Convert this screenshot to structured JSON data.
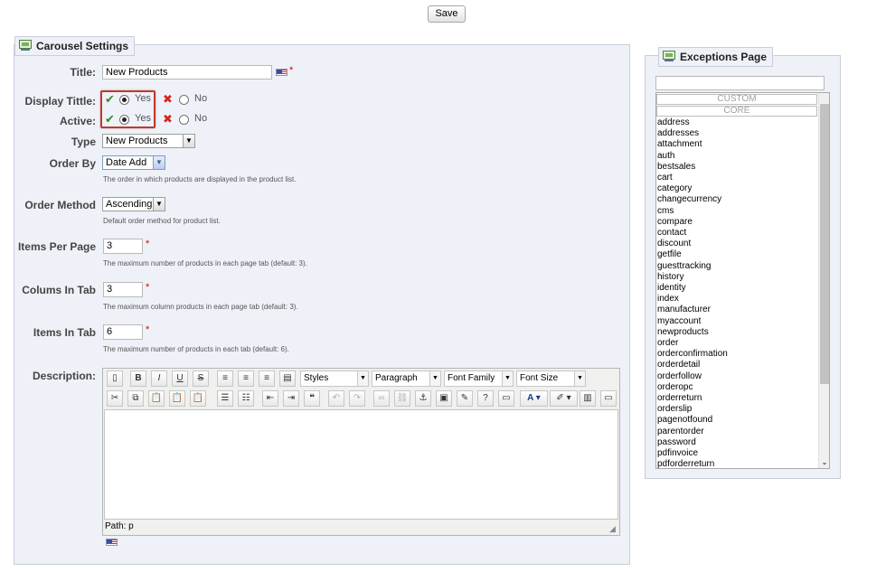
{
  "toolbar": {
    "save_label": "Save"
  },
  "carousel": {
    "legend": "Carousel Settings",
    "title_label": "Title:",
    "title_value": "New Products",
    "display_title_label": "Display Tittle:",
    "active_label": "Active:",
    "yes_label": "Yes",
    "no_label": "No",
    "type_label": "Type",
    "type_value": "New Products",
    "order_by_label": "Order By",
    "order_by_value": "Date Add",
    "order_by_hint": "The order in which products are displayed in the product list.",
    "order_method_label": "Order Method",
    "order_method_value": "Ascending",
    "order_method_hint": "Default order method for product list.",
    "items_per_page_label": "Items Per Page",
    "items_per_page_value": "3",
    "items_per_page_hint": "The maximum number of products in each page tab (default: 3).",
    "columns_label": "Colums In Tab",
    "columns_value": "3",
    "columns_hint": "The maximum column products in each page tab (default: 3).",
    "items_in_tab_label": "Items In Tab",
    "items_in_tab_value": "6",
    "items_in_tab_hint": "The maximum number of products in each tab (default: 6).",
    "description_label": "Description:",
    "required_mark": "*"
  },
  "editor": {
    "styles": "Styles",
    "paragraph": "Paragraph",
    "font_family": "Font Family",
    "font_size": "Font Size",
    "path": "Path: p"
  },
  "exceptions": {
    "legend": "Exceptions Page",
    "search_value": "",
    "custom_label": "CUSTOM",
    "core_label": "CORE",
    "pages": [
      "address",
      "addresses",
      "attachment",
      "auth",
      "bestsales",
      "cart",
      "category",
      "changecurrency",
      "cms",
      "compare",
      "contact",
      "discount",
      "getfile",
      "guesttracking",
      "history",
      "identity",
      "index",
      "manufacturer",
      "myaccount",
      "newproducts",
      "order",
      "orderconfirmation",
      "orderdetail",
      "orderfollow",
      "orderopc",
      "orderreturn",
      "orderslip",
      "pagenotfound",
      "parentorder",
      "password",
      "pdfinvoice",
      "pdforderreturn"
    ]
  },
  "colors": {
    "panel_bg": "#eff1f8",
    "panel_border": "#c8cdd8",
    "highlight": "#c0392b",
    "required": "#dd0000"
  }
}
